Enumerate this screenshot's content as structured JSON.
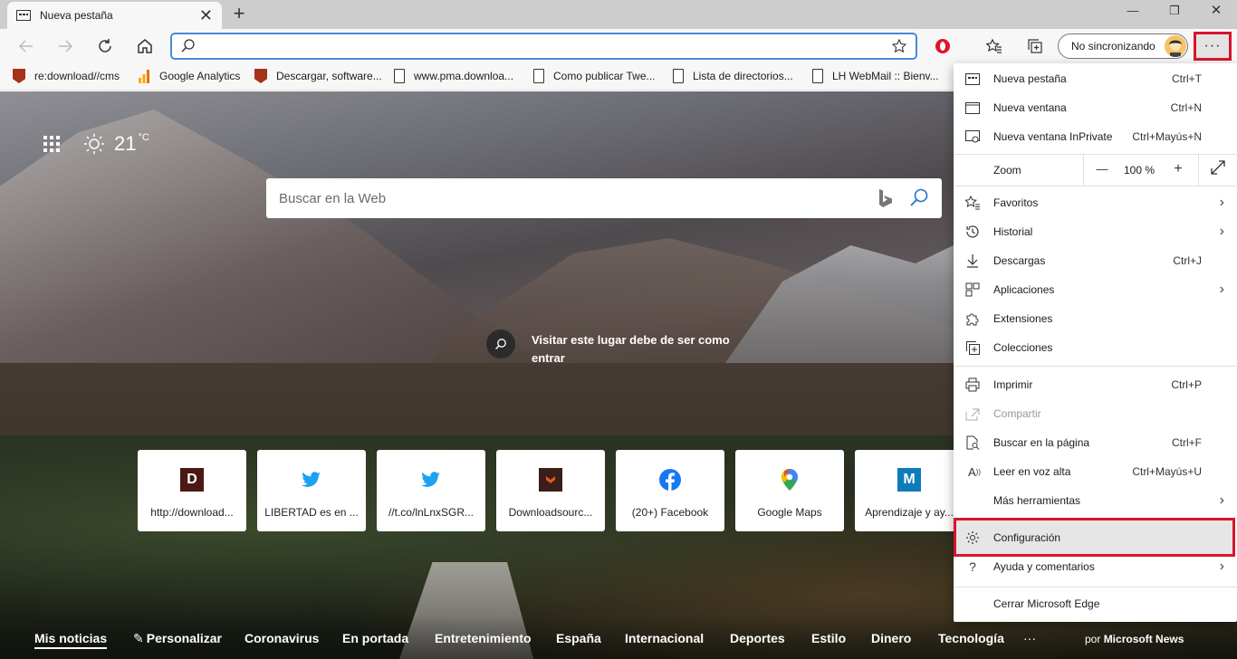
{
  "browser": {
    "tab_title": "Nueva pestaña",
    "address_value": "",
    "profile_label": "No sincronizando",
    "menu_button_label": "···"
  },
  "favorites": [
    {
      "label": "re:download//cms",
      "icon": "download-site-icon"
    },
    {
      "label": "Google Analytics",
      "icon": "analytics-icon"
    },
    {
      "label": "Descargar, software...",
      "icon": "download-site-icon"
    },
    {
      "label": "www.pma.downloa...",
      "icon": "page-icon"
    },
    {
      "label": "Como publicar Twe...",
      "icon": "page-icon"
    },
    {
      "label": "Lista de directorios...",
      "icon": "page-icon"
    },
    {
      "label": "LH WebMail :: Bienv...",
      "icon": "page-icon"
    }
  ],
  "newtab": {
    "temperature": "21",
    "temp_unit": "°C",
    "search_placeholder": "Buscar en la Web",
    "visit_text": "Visitar este lugar debe de ser como entrar",
    "tiles": [
      {
        "label": "http://download...",
        "icon": "d-letter-icon"
      },
      {
        "label": "LIBERTAD es en ...",
        "icon": "twitter-icon"
      },
      {
        "label": "//t.co/lnLnxSGR...",
        "icon": "twitter-icon"
      },
      {
        "label": "Downloadsourc...",
        "icon": "download-site-icon"
      },
      {
        "label": "(20+) Facebook",
        "icon": "facebook-icon"
      },
      {
        "label": "Google Maps",
        "icon": "maps-pin-icon"
      },
      {
        "label": "Aprendizaje y ay...",
        "icon": "m-letter-icon"
      }
    ],
    "news_tabs": [
      "Mis noticias",
      "Personalizar",
      "Coronavirus",
      "En portada",
      "Entretenimiento",
      "España",
      "Internacional",
      "Deportes",
      "Estilo",
      "Dinero",
      "Tecnología"
    ],
    "news_more": "···",
    "news_by_prefix": "por",
    "news_by_brand": "Microsoft News"
  },
  "menu": {
    "items": [
      {
        "label": "Nueva pestaña",
        "shortcut": "Ctrl+T"
      },
      {
        "label": "Nueva ventana",
        "shortcut": "Ctrl+N"
      },
      {
        "label": "Nueva ventana InPrivate",
        "shortcut": "Ctrl+Mayús+N"
      },
      {
        "label": "Favoritos",
        "shortcut": ""
      },
      {
        "label": "Historial",
        "shortcut": ""
      },
      {
        "label": "Descargas",
        "shortcut": "Ctrl+J"
      },
      {
        "label": "Aplicaciones",
        "shortcut": ""
      },
      {
        "label": "Extensiones",
        "shortcut": ""
      },
      {
        "label": "Colecciones",
        "shortcut": ""
      },
      {
        "label": "Imprimir",
        "shortcut": "Ctrl+P"
      },
      {
        "label": "Compartir",
        "shortcut": ""
      },
      {
        "label": "Buscar en la página",
        "shortcut": "Ctrl+F"
      },
      {
        "label": "Leer en voz alta",
        "shortcut": "Ctrl+Mayús+U"
      },
      {
        "label": "Más herramientas",
        "shortcut": ""
      },
      {
        "label": "Configuración",
        "shortcut": ""
      },
      {
        "label": "Ayuda y comentarios",
        "shortcut": ""
      },
      {
        "label": "Cerrar Microsoft Edge",
        "shortcut": ""
      }
    ],
    "zoom_label": "Zoom",
    "zoom_value": "100 %",
    "zoom_minus": "—",
    "zoom_plus": "+"
  },
  "colors": {
    "accent": "#4a8ad9",
    "highlight": "#d8142d"
  }
}
